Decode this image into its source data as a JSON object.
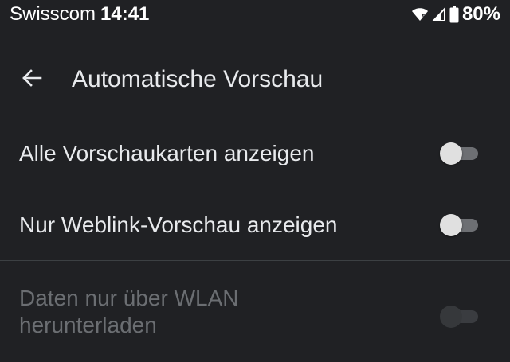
{
  "status_bar": {
    "carrier": "Swisscom",
    "time": "14:41",
    "battery_percent": "80%",
    "icons": [
      "wifi-icon",
      "cell-signal-icon",
      "battery-icon"
    ]
  },
  "app_bar": {
    "back_icon": "arrow-back-icon",
    "title": "Automatische Vorschau"
  },
  "settings": [
    {
      "label": "Alle Vorschaukarten anzeigen",
      "enabled": true,
      "checked": false
    },
    {
      "label": "Nur Weblink-Vorschau anzeigen",
      "enabled": true,
      "checked": false
    },
    {
      "label": "Daten nur über WLAN herunterladen",
      "enabled": false,
      "checked": false
    }
  ],
  "colors": {
    "background": "#202124",
    "text_primary": "#e8eaed",
    "text_disabled": "#6b6e72",
    "divider": "#3c4043"
  }
}
